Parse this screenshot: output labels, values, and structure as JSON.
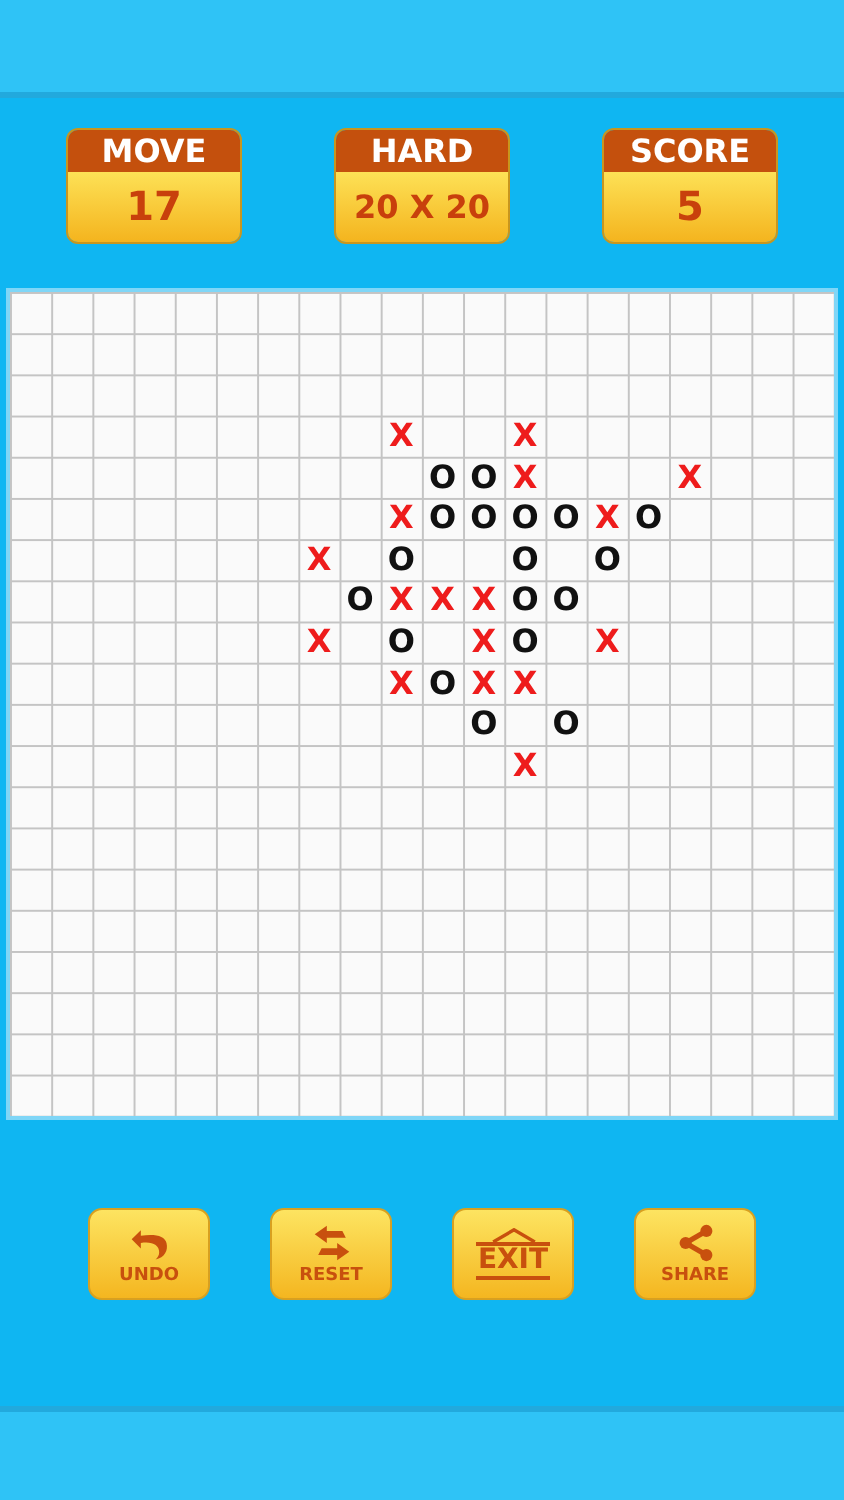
{
  "stats": [
    {
      "label": "MOVE",
      "value": "17"
    },
    {
      "label": "HARD",
      "value": "20 X 20"
    },
    {
      "label": "SCORE",
      "value": "5"
    }
  ],
  "board": {
    "rows": [
      [
        {},
        {},
        {},
        {},
        {},
        {},
        {},
        {},
        {},
        {},
        {},
        {},
        {},
        {},
        {},
        {},
        {},
        {},
        {},
        {}
      ],
      [
        {},
        {},
        {},
        {},
        {},
        {},
        {},
        {},
        {},
        {},
        {},
        {},
        {},
        {},
        {},
        {},
        {},
        {},
        {},
        {}
      ],
      [
        {},
        {},
        {},
        {},
        {},
        {},
        {},
        {},
        {},
        {},
        {},
        {},
        {},
        {},
        {},
        {},
        {},
        {},
        {},
        {}
      ],
      [
        {},
        {},
        {},
        {},
        {},
        {},
        {},
        {},
        {},
        {
          "mark": "X"
        },
        {},
        {},
        {
          "mark": "X"
        },
        {},
        {},
        {},
        {},
        {},
        {},
        {}
      ],
      [
        {},
        {},
        {},
        {},
        {},
        {},
        {},
        {},
        {},
        {},
        {
          "mark": "O"
        },
        {
          "mark": "O"
        },
        {
          "mark": "X"
        },
        {},
        {},
        {},
        {
          "mark": "X"
        },
        {},
        {},
        {}
      ],
      [
        {},
        {},
        {},
        {},
        {},
        {},
        {},
        {},
        {},
        {
          "mark": "X"
        },
        {
          "mark": "O"
        },
        {
          "mark": "O"
        },
        {
          "mark": "O"
        },
        {
          "mark": "O"
        },
        {
          "mark": "X"
        },
        {
          "mark": "O"
        },
        {},
        {},
        {},
        {}
      ],
      [
        {},
        {},
        {},
        {},
        {},
        {},
        {},
        {
          "mark": "X"
        },
        {},
        {
          "mark": "O"
        },
        {},
        {},
        {
          "mark": "O"
        },
        {},
        {
          "mark": "O"
        },
        {},
        {},
        {},
        {},
        {}
      ],
      [
        {},
        {},
        {},
        {},
        {},
        {},
        {},
        {},
        {
          "mark": "O"
        },
        {
          "mark": "X"
        },
        {
          "mark": "X"
        },
        {
          "mark": "X"
        },
        {
          "mark": "O"
        },
        {
          "mark": "O"
        },
        {},
        {},
        {},
        {},
        {},
        {}
      ],
      [
        {},
        {},
        {},
        {},
        {},
        {},
        {},
        {
          "mark": "X"
        },
        {},
        {
          "mark": "O"
        },
        {},
        {
          "mark": "X"
        },
        {
          "mark": "O"
        },
        {},
        {
          "mark": "X"
        },
        {},
        {},
        {},
        {},
        {}
      ],
      [
        {},
        {},
        {},
        {},
        {},
        {},
        {},
        {},
        {},
        {
          "mark": "X"
        },
        {
          "mark": "O"
        },
        {
          "mark": "X"
        },
        {
          "mark": "X"
        },
        {},
        {},
        {},
        {},
        {},
        {},
        {}
      ],
      [
        {},
        {},
        {},
        {},
        {},
        {},
        {},
        {},
        {},
        {},
        {},
        {
          "mark": "O"
        },
        {},
        {
          "mark": "O"
        },
        {},
        {},
        {},
        {},
        {},
        {}
      ],
      [
        {},
        {},
        {},
        {},
        {},
        {},
        {},
        {},
        {},
        {},
        {},
        {},
        {
          "mark": "X"
        },
        {},
        {},
        {},
        {},
        {},
        {},
        {}
      ],
      [
        {},
        {},
        {},
        {},
        {},
        {},
        {},
        {},
        {},
        {},
        {},
        {},
        {},
        {},
        {},
        {},
        {},
        {},
        {},
        {}
      ],
      [
        {},
        {},
        {},
        {},
        {},
        {},
        {},
        {},
        {},
        {},
        {},
        {},
        {},
        {},
        {},
        {},
        {},
        {},
        {},
        {}
      ],
      [
        {},
        {},
        {},
        {},
        {},
        {},
        {},
        {},
        {},
        {},
        {},
        {},
        {},
        {},
        {},
        {},
        {},
        {},
        {},
        {}
      ],
      [
        {},
        {},
        {},
        {},
        {},
        {},
        {},
        {},
        {},
        {},
        {},
        {},
        {},
        {},
        {},
        {},
        {},
        {},
        {},
        {}
      ],
      [
        {},
        {},
        {},
        {},
        {},
        {},
        {},
        {},
        {},
        {},
        {},
        {},
        {},
        {},
        {},
        {},
        {},
        {},
        {},
        {}
      ],
      [
        {},
        {},
        {},
        {},
        {},
        {},
        {},
        {},
        {},
        {},
        {},
        {},
        {},
        {},
        {},
        {},
        {},
        {},
        {},
        {}
      ],
      [
        {},
        {},
        {},
        {},
        {},
        {},
        {},
        {},
        {},
        {},
        {},
        {},
        {},
        {},
        {},
        {},
        {},
        {},
        {},
        {}
      ],
      [
        {},
        {},
        {},
        {},
        {},
        {},
        {},
        {},
        {},
        {},
        {},
        {},
        {},
        {},
        {},
        {},
        {},
        {},
        {},
        {}
      ]
    ]
  },
  "buttons": [
    {
      "kind": "undo",
      "label": "UNDO"
    },
    {
      "kind": "reset",
      "label": "RESET"
    },
    {
      "kind": "exit",
      "label": "EXIT"
    },
    {
      "kind": "share",
      "label": "SHARE"
    }
  ]
}
